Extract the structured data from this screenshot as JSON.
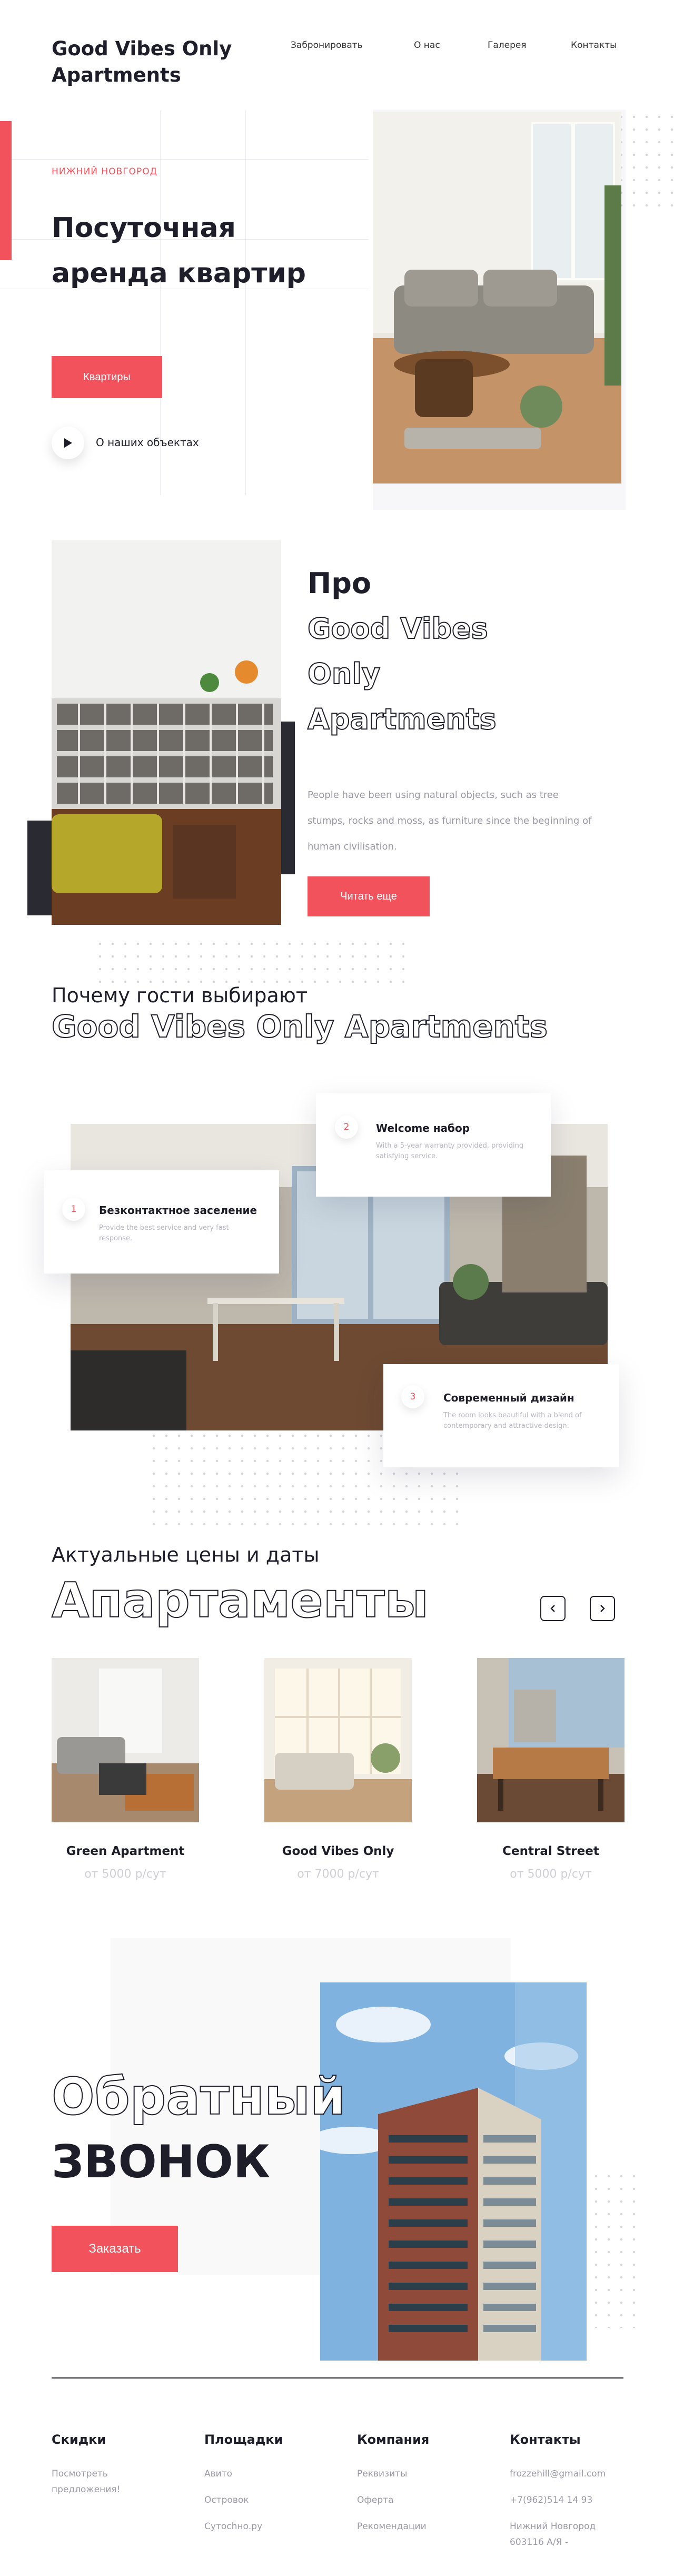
{
  "header": {
    "logo": "Good Vibes Only Apartments",
    "nav": [
      "Забронировать",
      "О нас",
      "Галерея",
      "Контакты"
    ]
  },
  "hero": {
    "city": "Нижний Новгород",
    "title": "Посуточная аренда квартир",
    "button": "Квартиры",
    "play_label": "О наших объектах"
  },
  "about": {
    "title_pro": "Про",
    "title_outline": [
      "Good Vibes",
      "Only",
      "Apartments"
    ],
    "text": "People have been using natural objects, such as tree stumps, rocks and moss, as furniture since the beginning of human civilisation.",
    "button": "Читать еще"
  },
  "why": {
    "title": "Почему гости выбирают",
    "subtitle": "Good Vibes Only Apartments",
    "features": [
      {
        "num": "1",
        "title": "Безконтактное заселение",
        "text": "Provide the best service and very fast response."
      },
      {
        "num": "2",
        "title": "Welcome набор",
        "text": "With a 5-year warranty provided, providing satisfying service."
      },
      {
        "num": "3",
        "title": "Современный дизайн",
        "text": "The room looks beautiful with a blend of contemporary and attractive design."
      }
    ]
  },
  "apartments": {
    "title": "Актуальные цены и даты",
    "subtitle": "Апартаменты",
    "items": [
      {
        "name": "Green Apartment",
        "price": "от 5000 р/сут"
      },
      {
        "name": "Good Vibes Only",
        "price": "от 7000 р/сут"
      },
      {
        "name": "Central Street",
        "price": "от 5000 р/сут"
      }
    ]
  },
  "callback": {
    "title_outline": "Обратный",
    "title_bold": "ЗВОНОК",
    "button": "Заказать"
  },
  "footer": {
    "columns": [
      {
        "title": "Скидки",
        "links": [
          "Посмотреть предложения!"
        ]
      },
      {
        "title": "Площадки",
        "links": [
          "Авито",
          "Островок",
          "Сутochно.ру"
        ]
      },
      {
        "title": "Компания",
        "links": [
          "Реквизиты",
          "Оферта",
          "Рекомендации"
        ]
      },
      {
        "title": "Контакты",
        "links": [
          "frozzehill@gmail.com",
          "+7(962)514 14 93",
          "Нижний Новгород 603116 А/Я -"
        ]
      }
    ]
  },
  "colors": {
    "accent": "#f2525c",
    "dark": "#1e1e2a",
    "muted": "#9a9aa6"
  }
}
